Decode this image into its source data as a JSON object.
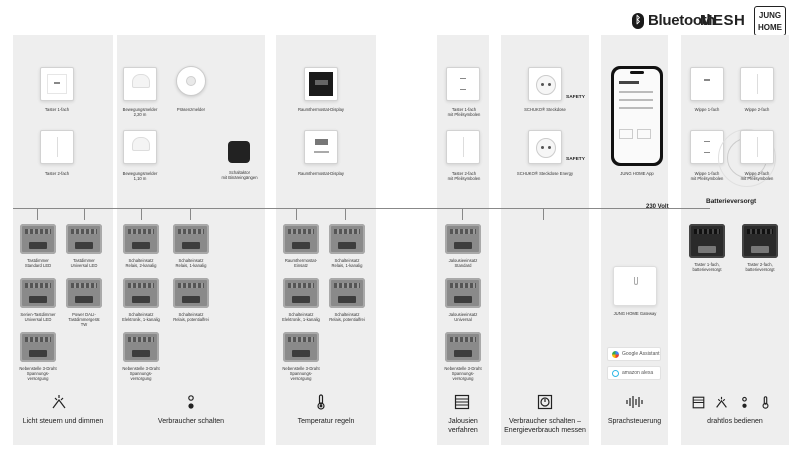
{
  "header": {
    "bluetooth_label": "Bluetooth",
    "mesh_label": "MESH",
    "brand_line1": "JUNG",
    "brand_line2": "HOME"
  },
  "bus": {
    "voltage_label": "230 Volt"
  },
  "devices": {
    "taster_1": "Taster 1-fach",
    "taster_2": "Taster 2-fach",
    "bewegung_220": "Bewegungsmelder\n2,20 m",
    "bewegung_110": "Bewegungsmelder\n1,10 m",
    "praesenz": "Präsenzmelder",
    "schaltaktor_binaer": "Schaltaktor\nmit Binäreingängen",
    "raumthermostat_1": "Raumthermostat-Display",
    "raumthermostat_2": "Raumthermostat-Display",
    "taster_1_pfeil": "Taster 1-fach\nmit Pfeilsymbolen",
    "taster_2_pfeil": "Taster 2-fach\nmit Pfeilsymbolen",
    "schuko": "SCHUKO® Steckdose",
    "schuko_energy": "SCHUKO® Steckdose Energy",
    "safety_1": "SAFETY",
    "safety_2": "SAFETY",
    "app": "JUNG HOME App",
    "wippe_1": "Wippe 1-fach",
    "wippe_2": "Wippe 2-fach",
    "wippe_1_pfeil": "Wippe 1-fach\nmit Pfeilsymbolen",
    "wippe_2_pfeil": "Wippe 2-fach\nmit Pfeilsymbolen",
    "batterie_label": "Batterieversorgt",
    "taster_1_batt": "Taster 1-fach,\nbatterieversorgt",
    "taster_2_batt": "Taster 2-fach,\nbatterieversorgt"
  },
  "inserts": {
    "tastdimmer_std": "Tastdimmer\nStandard LED",
    "tastdimmer_uni": "Tastdimmer\nUniversal LED",
    "serien_tastdimmer": "Serien-Tastdimmer\nUniversal LED",
    "power_dali": "Power DALI-\nTastdimmergerät\nTW",
    "nebenstelle_1": "Nebenstelle 3-Draht\nSpannungs-\nversorgung",
    "schalt_relais_2": "Schalteinsatz\nRelais, 2-kanalig",
    "schalt_relais_1": "Schalteinsatz\nRelais, 1-kanalig",
    "schalt_elektronik": "Schalteinsatz\nElektronik, 1-kanalig",
    "schalt_potfrei": "Schalteinsatz\nRelais, potentialfrei",
    "nebenstelle_2": "Nebenstelle 3-Draht\nSpannungs-\nversorgung",
    "raumthermostat_einsatz": "Raumthermostat-\nEinsatz",
    "schalt_relais_1b": "Schalteinsatz\nRelais, 1-kanalig",
    "schalt_elektronik_b": "Schalteinsatz\nElektronik, 1-kanalig",
    "schalt_potfrei_b": "Schalteinsatz\nRelais, potentialfrei",
    "nebenstelle_3": "Nebenstelle 3-Draht\nSpannungs-\nversorgung",
    "jalousie_std": "Jalousieeinsatz\nStandard",
    "jalousie_uni": "Jalousieeinsatz\nUniversal",
    "nebenstelle_4": "Nebenstelle 3-Draht\nSpannungs-\nversorgung",
    "gateway": "JUNG HOME Gateway"
  },
  "assistants": {
    "google": "Google Assistant",
    "alexa": "amazon alexa"
  },
  "categories": {
    "licht": "Licht steuern und dimmen",
    "verbraucher": "Verbraucher schalten",
    "temperatur": "Temperatur regeln",
    "jalousien": "Jalousien\nverfahren",
    "energie": "Verbraucher schalten –\nEnergieverbrauch messen",
    "sprach": "Sprachsteuerung",
    "drahtlos": "drahtlos bedienen"
  },
  "colors": {
    "column_bg": "#eeeeee",
    "bus_line": "#888888",
    "safety_accent": "#222222"
  }
}
